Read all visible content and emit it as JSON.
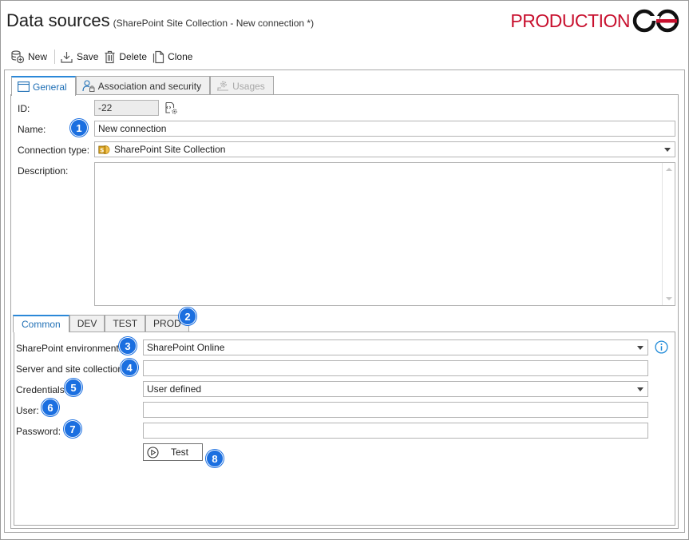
{
  "header": {
    "title": "Data sources",
    "subtitle": "(SharePoint Site Collection - New connection *)",
    "brand_text": "PRODUCTION",
    "brand_color": "#c8102e"
  },
  "toolbar": {
    "new_label": "New",
    "save_label": "Save",
    "delete_label": "Delete",
    "clone_label": "Clone"
  },
  "tabs": {
    "general": "General",
    "association": "Association and security",
    "usages": "Usages"
  },
  "form": {
    "id_label": "ID:",
    "id_value": "-22",
    "name_label": "Name:",
    "name_value": "New connection",
    "connection_type_label": "Connection type:",
    "connection_type_value": "SharePoint Site Collection",
    "description_label": "Description:",
    "description_value": ""
  },
  "env_tabs": {
    "common": "Common",
    "dev": "DEV",
    "test": "TEST",
    "prod": "PROD"
  },
  "common": {
    "sp_env_label": "SharePoint environment:",
    "sp_env_value": "SharePoint Online",
    "server_label": "Server and site collection:",
    "server_value": "",
    "credentials_label": "Credentials:",
    "credentials_value": "User defined",
    "user_label": "User:",
    "user_value": "",
    "password_label": "Password:",
    "password_value": "",
    "test_button": "Test"
  },
  "badges": [
    "1",
    "2",
    "3",
    "4",
    "5",
    "6",
    "7",
    "8"
  ],
  "colors": {
    "accent": "#2b88d8",
    "badge": "#1b6fe0"
  }
}
